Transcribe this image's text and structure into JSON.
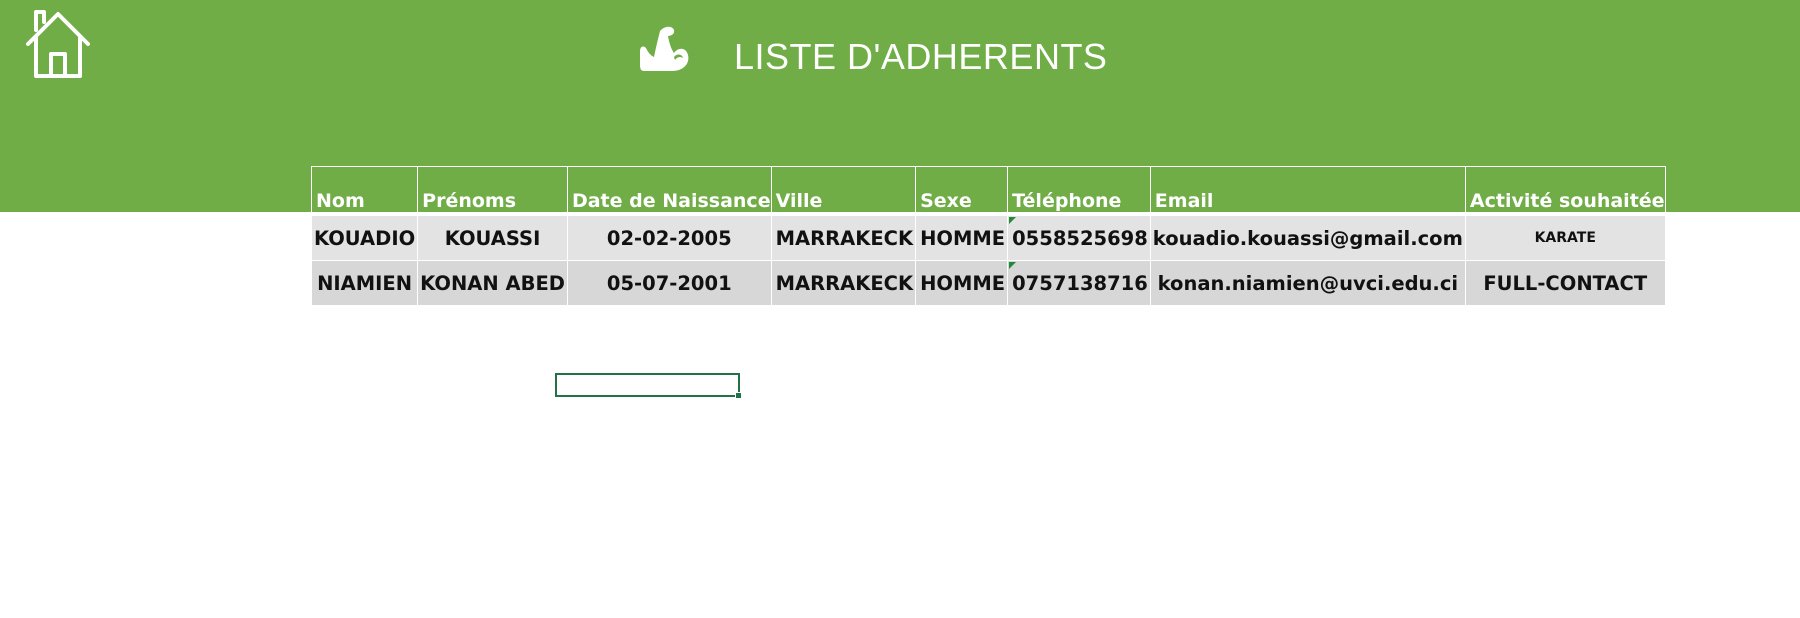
{
  "header": {
    "title": "LISTE D'ADHERENTS",
    "background_color": "#70ad47",
    "home_icon": "home-icon",
    "title_icon": "flexed-bicep-icon"
  },
  "table": {
    "columns": [
      "Nom",
      "Prénoms",
      "Date de Naissance",
      "Ville",
      "Sexe",
      "Téléphone",
      "Email",
      "Activité souhaitée"
    ],
    "rows": [
      [
        "KOUADIO",
        "KOUASSI",
        "02-02-2005",
        "MARRAKECK",
        "HOMME",
        "0558525698",
        "kouadio.kouassi@gmail.com",
        "KARATE"
      ],
      [
        "NIAMIEN",
        "KONAN ABED",
        "05-07-2001",
        "MARRAKECK",
        "HOMME",
        "0757138716",
        "konan.niamien@uvci.edu.ci",
        "FULL-CONTACT"
      ]
    ],
    "row_colors": [
      "#e3e3e3",
      "#d7d7d7"
    ]
  },
  "selection": {
    "active_cell_color": "#217346"
  }
}
